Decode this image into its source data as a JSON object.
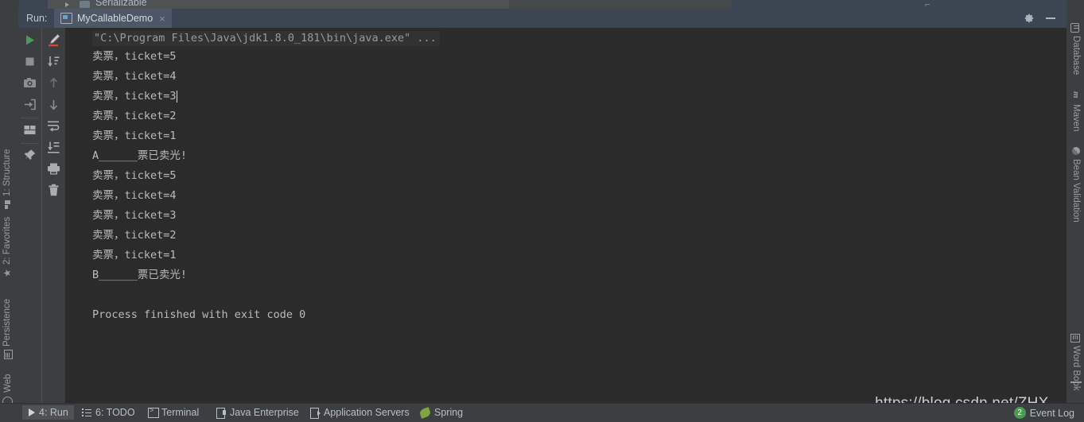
{
  "window": {
    "editor_remnant_label": "Serializable",
    "gear_icon": "gear-icon",
    "minimize_icon": "minimize-icon"
  },
  "run_panel": {
    "run_label": "Run:",
    "tab": {
      "title": "MyCallableDemo",
      "icon": "run-configuration-icon",
      "close": "×"
    },
    "toolbar_primary": [
      {
        "name": "rerun-button",
        "icon": "play-icon",
        "color": "#499c54"
      },
      {
        "name": "stop-button",
        "icon": "stop-square-icon",
        "color": "#8b8f92"
      },
      {
        "name": "screenshot-button",
        "icon": "camera-icon",
        "color": "#8b8f92"
      },
      {
        "name": "dump-threads-button",
        "icon": "import-arrow-icon",
        "color": "#8b8f92"
      },
      {
        "name": "layout-settings-button",
        "icon": "layout-icon",
        "color": "#a9adb0"
      },
      {
        "name": "pin-tab-button",
        "icon": "pin-icon",
        "color": "#a9adb0"
      }
    ],
    "toolbar_secondary": [
      {
        "name": "toggle-console-highlight-button",
        "icon": "marker-pen-icon",
        "color": "#c9ced3"
      },
      {
        "name": "scroll-to-bottom-button",
        "icon": "scroll-down-icon",
        "color": "#a9adb0"
      },
      {
        "name": "previous-occurrence-button",
        "icon": "arrow-up-icon",
        "color": "#6e7275"
      },
      {
        "name": "next-occurrence-button",
        "icon": "arrow-down-icon",
        "color": "#8b8f92"
      },
      {
        "name": "soft-wrap-button",
        "icon": "soft-wrap-icon",
        "color": "#a9adb0"
      },
      {
        "name": "scroll-to-end-button",
        "icon": "scroll-end-icon",
        "color": "#a9adb0"
      },
      {
        "name": "print-button",
        "icon": "printer-icon",
        "color": "#a9adb0"
      },
      {
        "name": "clear-all-button",
        "icon": "trash-icon",
        "color": "#a9adb0"
      }
    ]
  },
  "console": {
    "command_line": "\"C:\\Program Files\\Java\\jdk1.8.0_181\\bin\\java.exe\" ...",
    "lines": [
      {
        "text": "卖票，ticket=5",
        "style": "normal"
      },
      {
        "text": "卖票，ticket=4",
        "style": "normal"
      },
      {
        "text": "卖票，ticket=3",
        "style": "caret"
      },
      {
        "text": "卖票，ticket=2",
        "style": "normal"
      },
      {
        "text": "卖票，ticket=1",
        "style": "normal"
      },
      {
        "text": "A______票已卖光!",
        "style": "normal"
      },
      {
        "text": "卖票，ticket=5",
        "style": "normal"
      },
      {
        "text": "卖票，ticket=4",
        "style": "normal"
      },
      {
        "text": "卖票，ticket=3",
        "style": "normal"
      },
      {
        "text": "卖票，ticket=2",
        "style": "normal"
      },
      {
        "text": "卖票，ticket=1",
        "style": "normal"
      },
      {
        "text": "B______票已卖光!",
        "style": "normal"
      },
      {
        "text": "",
        "style": "normal"
      },
      {
        "text": "Process finished with exit code 0",
        "style": "normal"
      }
    ]
  },
  "sidebar_left": [
    {
      "label": "1: Structure",
      "icon": "structure-icon"
    },
    {
      "label": "2: Favorites",
      "icon": "star-icon"
    },
    {
      "label": "Persistence",
      "icon": "persistence-icon"
    },
    {
      "label": "Web",
      "icon": "web-globe-icon"
    }
  ],
  "sidebar_right_top": [
    {
      "label": "Database",
      "icon": "database-icon"
    },
    {
      "label": "Maven",
      "icon": "maven-m-icon"
    },
    {
      "label": "Bean Validation",
      "icon": "bean-validation-icon"
    }
  ],
  "sidebar_right_bottom": [
    {
      "label": "Word Book",
      "icon": "word-book-icon"
    }
  ],
  "status_bar": {
    "items": [
      {
        "label": "4: Run",
        "icon": "run-icon",
        "active": true
      },
      {
        "label": "6: TODO",
        "icon": "todo-icon",
        "active": false
      },
      {
        "label": "Terminal",
        "icon": "terminal-icon",
        "active": false
      },
      {
        "label": "Java Enterprise",
        "icon": "java-enterprise-icon",
        "active": false
      },
      {
        "label": "Application Servers",
        "icon": "application-servers-icon",
        "active": false
      },
      {
        "label": "Spring",
        "icon": "spring-leaf-icon",
        "active": false
      }
    ],
    "event_log": {
      "label": "Event Log",
      "count": "2",
      "badge_color": "#499c54"
    }
  },
  "watermark": {
    "text": "https://blog.csdn.net/ZHX__"
  },
  "colors": {
    "console_bg": "#2b2b2b",
    "panel_bg": "#3c3f41",
    "tabbar_bg": "#3c4552",
    "tab_active_bg": "#4c5866",
    "console_text": "#bbbbbb",
    "command_text": "#9a9a9a",
    "accent_green": "#499c54"
  }
}
